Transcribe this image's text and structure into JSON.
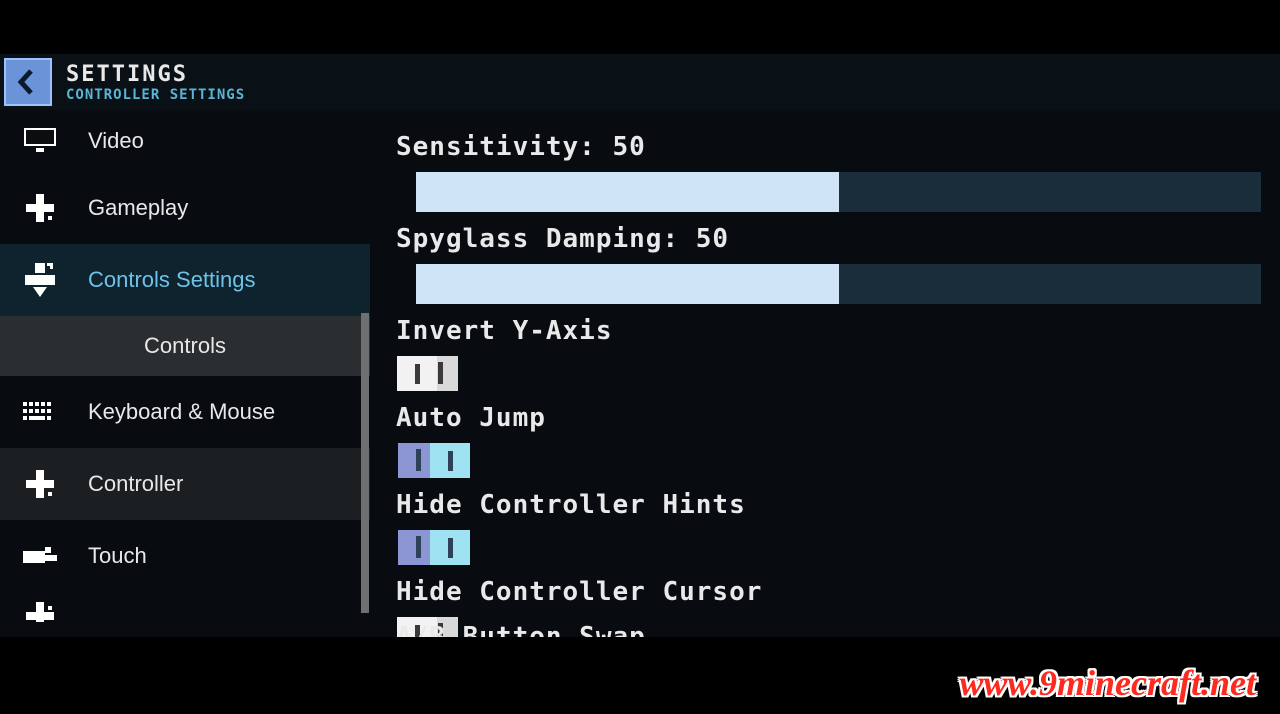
{
  "header": {
    "title": "SETTINGS",
    "subtitle": "CONTROLLER SETTINGS"
  },
  "sidebar": {
    "items": [
      {
        "label": "Video",
        "icon": "monitor-icon"
      },
      {
        "label": "Gameplay",
        "icon": "dpad-plus-icon"
      },
      {
        "label": "Controls Settings",
        "icon": "dpad-arrow-icon",
        "selected": true
      },
      {
        "label": "Controls",
        "sub": true,
        "active": true
      },
      {
        "label": "Keyboard & Mouse",
        "icon": "keyboard-icon"
      },
      {
        "label": "Controller",
        "icon": "dpad-small-icon"
      },
      {
        "label": "Touch",
        "icon": "hand-icon"
      },
      {
        "label": "",
        "icon": "dpad-plus-icon",
        "cut": true
      }
    ]
  },
  "main": {
    "sliders": {
      "sensitivity": {
        "label": "Sensitivity: 50",
        "value": 50
      },
      "spyglass": {
        "label": "Spyglass Damping: 50",
        "value": 50
      }
    },
    "toggles": {
      "inverty": {
        "label": "Invert Y-Axis",
        "state": false
      },
      "autojump": {
        "label": "Auto Jump",
        "state": true
      },
      "hidehints": {
        "label": "Hide Controller Hints",
        "state": true
      },
      "hidecursor": {
        "label": "Hide Controller Cursor",
        "state": false
      }
    },
    "cutoff_label": "A/B Button Swap"
  },
  "watermark": "www.9minecraft.net"
}
